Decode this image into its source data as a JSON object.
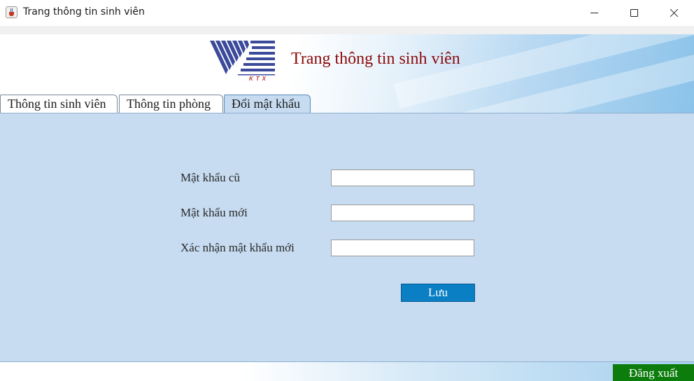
{
  "window": {
    "title": "Trang thông tin sinh viên",
    "app_icon": "java-cup-icon",
    "controls": [
      "minimize-icon",
      "maximize-icon",
      "close-icon"
    ]
  },
  "header": {
    "logo_text": "KTX",
    "title": "Trang thông tin sinh viên",
    "title_color": "#8b0a0a"
  },
  "tabs": [
    {
      "label": "Thông tin sinh viên",
      "selected": false
    },
    {
      "label": "Thông tin phòng",
      "selected": false
    },
    {
      "label": "Đổi mật khẩu",
      "selected": true
    }
  ],
  "form": {
    "old_password_label": "Mật khẩu cũ",
    "old_password_value": "",
    "new_password_label": "Mật khẩu mới",
    "new_password_value": "",
    "confirm_password_label": "Xác nhận mật khẩu mới",
    "confirm_password_value": "",
    "save_label": "Lưu"
  },
  "footer": {
    "logout_label": "Đăng xuất"
  },
  "colors": {
    "panel_bg": "#c7dcf1",
    "save_button": "#0a7fc4",
    "logout_button": "#0c7c0c"
  }
}
